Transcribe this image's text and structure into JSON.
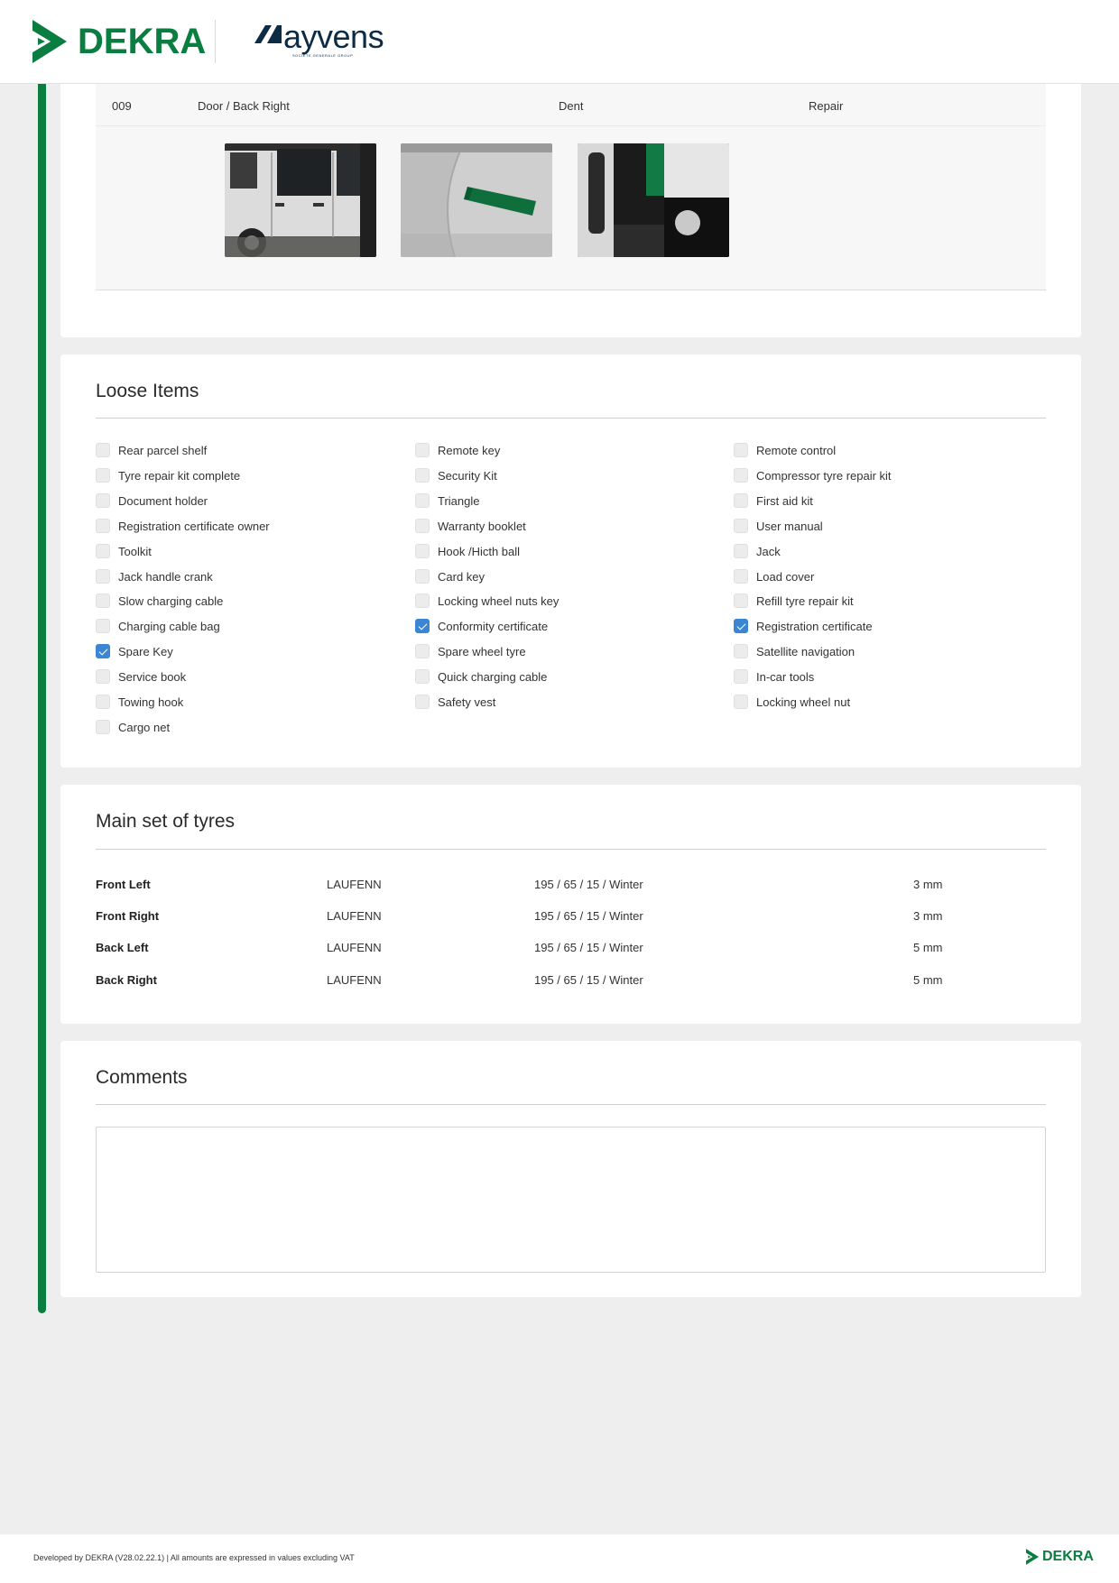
{
  "header": {
    "dekra_logo_text": "DEKRA",
    "ayvens_logo_text": "ayvens",
    "ayvens_sub_text": "SOCIETE GENERALE GROUP"
  },
  "damage": {
    "number": "009",
    "location": "Door / Back Right",
    "type": "Dent",
    "action": "Repair",
    "photos": [
      "damage-photo-1",
      "damage-photo-2",
      "damage-photo-3"
    ]
  },
  "loose_items": {
    "title": "Loose Items",
    "columns": [
      [
        {
          "label": "Rear parcel shelf",
          "checked": false
        },
        {
          "label": "Tyre repair kit complete",
          "checked": false
        },
        {
          "label": "Document holder",
          "checked": false
        },
        {
          "label": "Registration certificate owner",
          "checked": false
        },
        {
          "label": "Toolkit",
          "checked": false
        },
        {
          "label": "Jack handle crank",
          "checked": false
        },
        {
          "label": "Slow charging cable",
          "checked": false
        },
        {
          "label": "Charging cable bag",
          "checked": false
        },
        {
          "label": "Spare Key",
          "checked": true
        },
        {
          "label": "Service book",
          "checked": false
        },
        {
          "label": "Towing hook",
          "checked": false
        },
        {
          "label": "Cargo net",
          "checked": false
        }
      ],
      [
        {
          "label": "Remote key",
          "checked": false
        },
        {
          "label": "Security Kit",
          "checked": false
        },
        {
          "label": "Triangle",
          "checked": false
        },
        {
          "label": "Warranty booklet",
          "checked": false
        },
        {
          "label": "Hook /Hicth ball",
          "checked": false
        },
        {
          "label": "Card key",
          "checked": false
        },
        {
          "label": "Locking wheel nuts key",
          "checked": false
        },
        {
          "label": "Conformity certificate",
          "checked": true
        },
        {
          "label": "Spare wheel tyre",
          "checked": false
        },
        {
          "label": "Quick charging cable",
          "checked": false
        },
        {
          "label": "Safety vest",
          "checked": false
        }
      ],
      [
        {
          "label": "Remote control",
          "checked": false
        },
        {
          "label": "Compressor tyre repair kit",
          "checked": false
        },
        {
          "label": "First aid kit",
          "checked": false
        },
        {
          "label": "User manual",
          "checked": false
        },
        {
          "label": "Jack",
          "checked": false
        },
        {
          "label": "Load cover",
          "checked": false
        },
        {
          "label": "Refill tyre repair kit",
          "checked": false
        },
        {
          "label": "Registration certificate",
          "checked": true
        },
        {
          "label": "Satellite navigation",
          "checked": false
        },
        {
          "label": "In-car tools",
          "checked": false
        },
        {
          "label": "Locking wheel nut",
          "checked": false
        }
      ]
    ]
  },
  "tyres": {
    "title": "Main set of tyres",
    "rows": [
      {
        "position": "Front Left",
        "brand": "LAUFENN",
        "spec": "195 / 65 / 15 / Winter",
        "depth": "3 mm"
      },
      {
        "position": "Front Right",
        "brand": "LAUFENN",
        "spec": "195 / 65 / 15 / Winter",
        "depth": "3 mm"
      },
      {
        "position": "Back Left",
        "brand": "LAUFENN",
        "spec": "195 / 65 / 15 / Winter",
        "depth": "5 mm"
      },
      {
        "position": "Back Right",
        "brand": "LAUFENN",
        "spec": "195 / 65 / 15 / Winter",
        "depth": "5 mm"
      }
    ]
  },
  "comments": {
    "title": "Comments",
    "value": ""
  },
  "footer": {
    "text": "Developed by DEKRA (V28.02.22.1) | All amounts are expressed in values excluding VAT",
    "logo_text": "DEKRA"
  },
  "colors": {
    "brand_green": "#0a7d40",
    "check_blue": "#3a86d4",
    "ayvens_navy": "#0d2b45"
  }
}
